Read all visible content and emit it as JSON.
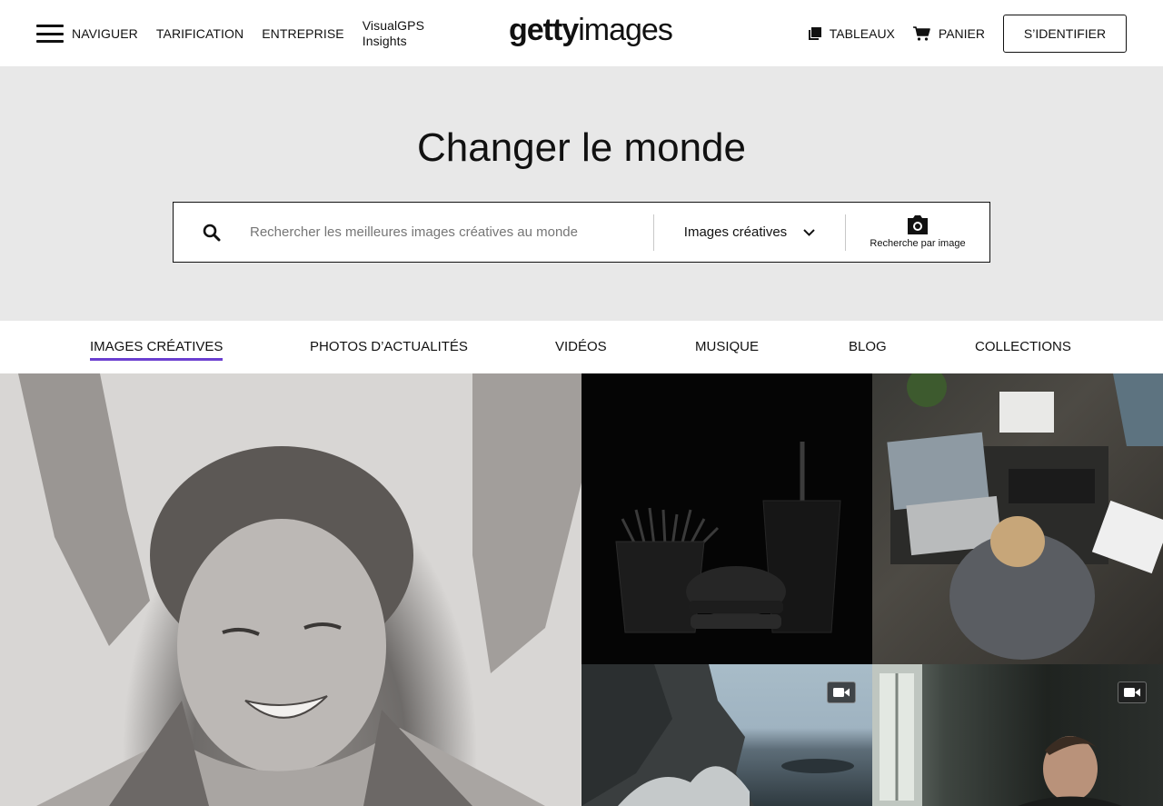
{
  "header": {
    "nav": {
      "browse": "NAVIGUER",
      "pricing": "TARIFICATION",
      "enterprise": "ENTREPRISE",
      "insights": "VisualGPS\nInsights"
    },
    "logo": {
      "bold": "getty",
      "light": "images"
    },
    "boards": "TABLEAUX",
    "cart": "PANIER",
    "signin": "S’IDENTIFIER"
  },
  "hero": {
    "title": "Changer le monde",
    "search": {
      "placeholder": "Rechercher les meilleures images créatives au monde",
      "value": "",
      "type_selected": "Images créatives",
      "image_search_label": "Recherche par image"
    }
  },
  "tabs": [
    {
      "label": "IMAGES CRÉATIVES",
      "active": true
    },
    {
      "label": "PHOTOS D’ACTUALITÉS",
      "active": false
    },
    {
      "label": "VIDÉOS",
      "active": false
    },
    {
      "label": "MUSIQUE",
      "active": false
    },
    {
      "label": "BLOG",
      "active": false
    },
    {
      "label": "COLLECTIONS",
      "active": false
    }
  ],
  "colors": {
    "accent": "#6b3fd0",
    "hero_bg": "#e8e8e8",
    "text": "#111111"
  },
  "icons": [
    "hamburger-icon",
    "board-icon",
    "cart-icon",
    "search-icon",
    "chevron-down-icon",
    "camera-icon",
    "video-camera-icon"
  ]
}
